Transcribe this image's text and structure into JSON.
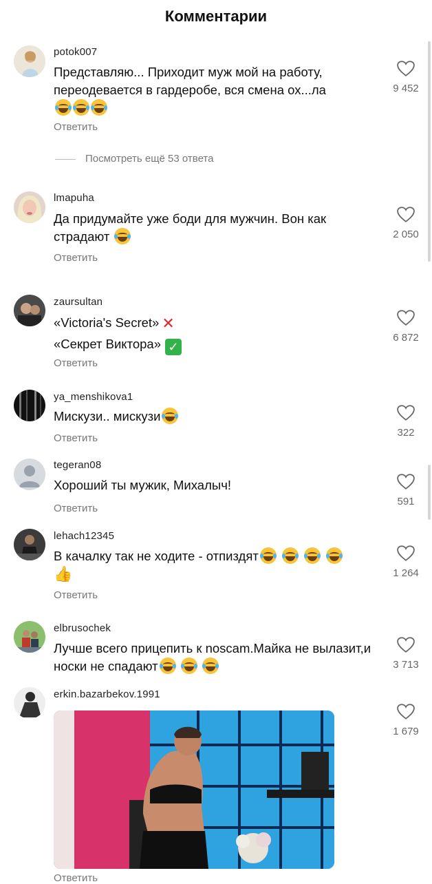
{
  "header": {
    "title": "Комментарии"
  },
  "reply_label": "Ответить",
  "view_more": "Посмотреть ещё 53 ответа",
  "comments": [
    {
      "username": "potok007",
      "text": "Представляю... Приходит муж мой на работу, переодевается в гардеробе, вся смена ох...ла",
      "likes": "9 452"
    },
    {
      "username": "lmapuha",
      "text": "Да придумайте уже боди для мужчин.  Вон как страдают",
      "likes": "2 050"
    },
    {
      "username": "zaursultan",
      "text_line1": "«Victoria's Secret»",
      "text_line2": "«Секрет Виктора»",
      "likes": "6 872"
    },
    {
      "username": "ya_menshikova1",
      "text": "Мискузи.. мискузи",
      "likes": "322"
    },
    {
      "username": "tegeran08",
      "text": "Хороший ты мужик, Михалыч!",
      "likes": "591"
    },
    {
      "username": "lehach12345",
      "text": "В качалку так не ходите - отпиздят",
      "likes": "1 264"
    },
    {
      "username": "elbrusochek",
      "text": "Лучше всего прицепить к noscam.Майка не вылазит,и носки не спадают",
      "likes": "3 713"
    },
    {
      "username": "erkin.bazarbekov.1991",
      "likes": "1 679"
    }
  ],
  "colors": {
    "text": "#111111",
    "secondary": "#777777",
    "like_outline": "#666666",
    "emoji": "#f7c43a",
    "cross": "#e0262b",
    "check": "#34b24a"
  },
  "icons": {
    "like": "heart-outline-icon",
    "laugh": "face-with-tears-of-joy",
    "cross": "cross-mark",
    "check": "check-mark-button",
    "thumb": "thumbs-up"
  }
}
